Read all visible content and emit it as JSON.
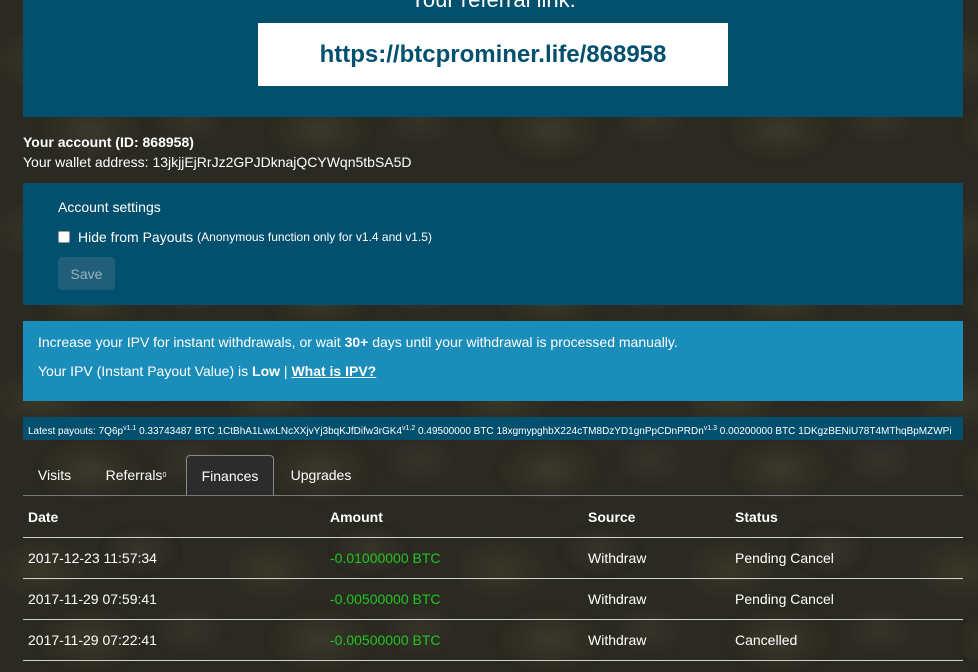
{
  "referral": {
    "title": "Your referral link:",
    "link": "https://btcprominer.life/868958"
  },
  "account": {
    "id_line": "Your account (ID: 868958)",
    "wallet_line": "Your wallet address: 13jkjjEjRrJz2GPJDknajQCYWqn5tbSA5D"
  },
  "settings": {
    "title": "Account settings",
    "hide_label": "Hide from Payouts",
    "hide_note": "(Anonymous function only for v1.4 and v1.5)",
    "hide_checked": false,
    "save_label": "Save"
  },
  "ipv": {
    "line1_a": "Increase your IPV for instant withdrawals, or wait ",
    "line1_days": "30+",
    "line1_b": " days until your withdrawal is processed manually.",
    "line2_a": "Your IPV (Instant Payout Value) is ",
    "level": "Low",
    "sep": " | ",
    "link": "What is IPV?"
  },
  "payouts": {
    "label": "Latest payouts:",
    "items": [
      {
        "user": "7Q6p",
        "ver": "v1.1",
        "amount": "0.33743487 BTC",
        "addr": "1CtBhA1LwxLNcXXjvYj3bqKJfDifw3rGK4",
        "ver2": "v1.2"
      },
      {
        "amount": "0.49500000 BTC",
        "addr": "18xgmypghbX224cTM8DzYD1gnPpCDnPRDn",
        "ver2": "v1.3"
      },
      {
        "amount": "0.00200000 BTC",
        "addr": "1DKgzBENiU78T4MThqBpMZWPi"
      }
    ]
  },
  "tabs": {
    "visits": "Visits",
    "referrals": "Referrals",
    "referrals_count": "0",
    "finances": "Finances",
    "upgrades": "Upgrades"
  },
  "table": {
    "headers": [
      "Date",
      "Amount",
      "Source",
      "Status"
    ],
    "rows": [
      {
        "date": "2017-12-23 11:57:34",
        "amount": "-0.01000000 BTC",
        "source": "Withdraw",
        "status": "Pending Cancel"
      },
      {
        "date": "2017-11-29 07:59:41",
        "amount": "-0.00500000 BTC",
        "source": "Withdraw",
        "status": "Pending Cancel"
      },
      {
        "date": "2017-11-29 07:22:41",
        "amount": "-0.00500000 BTC",
        "source": "Withdraw",
        "status": "Cancelled"
      }
    ]
  },
  "colors": {
    "panel_dark": "#02506e",
    "panel_light": "#1b8dba",
    "amount_green": "#21c521"
  }
}
